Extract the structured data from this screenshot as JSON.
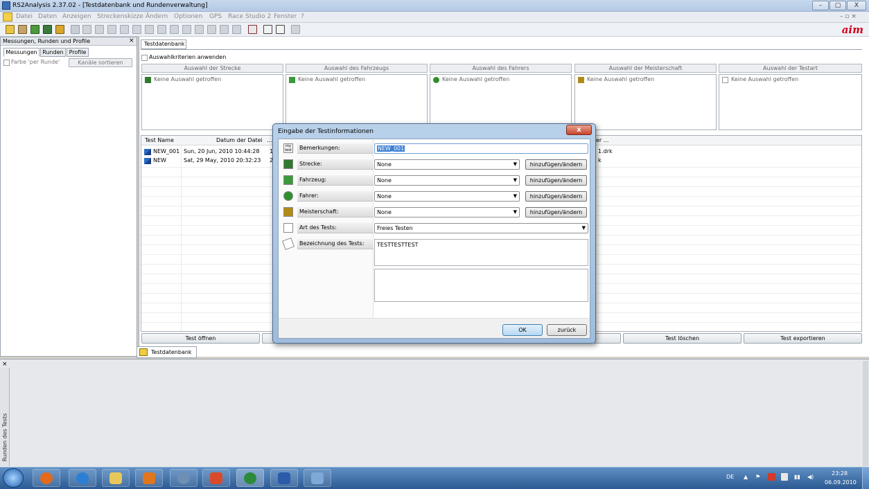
{
  "window": {
    "title": "RS2Analysis 2.37.02 - [Testdatenbank und Rundenverwaltung]",
    "min": "–",
    "max": "▢",
    "close": "X"
  },
  "menu": [
    "Datei",
    "Daten",
    "Anzeigen",
    "Streckenskizze",
    "Ändern",
    "Optionen",
    "GPS",
    "Race Studio 2",
    "Fenster",
    "?"
  ],
  "logo": "aim",
  "left_panel": {
    "header": "Messungen, Runden und Profile",
    "close": "×",
    "tabs": [
      "Messungen",
      "Runden",
      "Profile"
    ],
    "checkbox_label": "Farbe 'per Runde'",
    "sort_button": "Kanäle sortieren"
  },
  "main": {
    "tab": "Testdatenbank",
    "criteria_label": "Auswahlkriterien anwenden",
    "columns": [
      {
        "header": "Auswahl der Strecke",
        "value": "Keine Auswahl getroffen",
        "icon_color": "#2f7a2f"
      },
      {
        "header": "Auswahl des Fahrzeugs",
        "value": "Keine Auswahl getroffen",
        "icon_color": "#3a9a3a"
      },
      {
        "header": "Auswahl des Fahrers",
        "value": "Keine Auswahl getroffen",
        "icon_color": "#2d8f2d"
      },
      {
        "header": "Auswahl der Meisterschaft",
        "value": "Keine Auswahl getroffen",
        "icon_color": "#b08a14"
      },
      {
        "header": "Auswahl der Testart",
        "value": "Keine Auswahl getroffen",
        "icon_color": "#9a9a9a"
      }
    ],
    "grid": {
      "headers": [
        "Test Name",
        "Datum der Datei",
        "...",
        "er ..."
      ],
      "rows": [
        {
          "name": "NEW_001",
          "date": "Sun, 20 Jun, 2010  10:44:28",
          "c3": "1",
          "file": "1.drk"
        },
        {
          "name": "NEW",
          "date": "Sat, 29 May, 2010  20:32:23",
          "c3": "2",
          "file": "k"
        }
      ]
    },
    "buttons": {
      "open": "Test öffnen",
      "delete": "Test löschen",
      "export": "Test exportieren"
    },
    "bottom_tab": "Testdatenbank"
  },
  "lower_panel": {
    "close": "×",
    "label": "Runden des Tests"
  },
  "dialog": {
    "title": "Eingabe der Testinformationen",
    "close": "x",
    "fields": {
      "remarks_label": "Bemerkungen:",
      "remarks_value": "NEW_001",
      "track_label": "Strecke:",
      "track_value": "None",
      "vehicle_label": "Fahrzeug:",
      "vehicle_value": "None",
      "driver_label": "Fahrer:",
      "driver_value": "None",
      "championship_label": "Meisterschaft:",
      "championship_value": "None",
      "testtype_label": "Art des Tests:",
      "testtype_value": "Freies Testen",
      "desc_label": "Bezeichnung des Tests:",
      "desc_value": "TESTTESTTEST"
    },
    "add_button": "hinzufügen/ändern",
    "ok": "OK",
    "back": "zurück",
    "my_test_icon": "my test"
  },
  "taskbar": {
    "lang": "DE",
    "time": "23:28",
    "date": "06.09.2010",
    "items": [
      {
        "icon": "firefox-icon",
        "color": "#e36a1b"
      },
      {
        "icon": "ie-icon",
        "color": "#2c7fd3"
      },
      {
        "icon": "explorer-icon",
        "color": "#e8c75a"
      },
      {
        "icon": "media-icon",
        "color": "#e0761e"
      },
      {
        "icon": "app-icon",
        "color": "#6e8fb4"
      },
      {
        "icon": "aim-app-icon",
        "color": "#d94a2a"
      },
      {
        "icon": "globe-icon",
        "color": "#2d8a3a"
      },
      {
        "icon": "word-icon",
        "color": "#2a5cab"
      },
      {
        "icon": "paint-icon",
        "color": "#7fa7d8"
      }
    ]
  }
}
